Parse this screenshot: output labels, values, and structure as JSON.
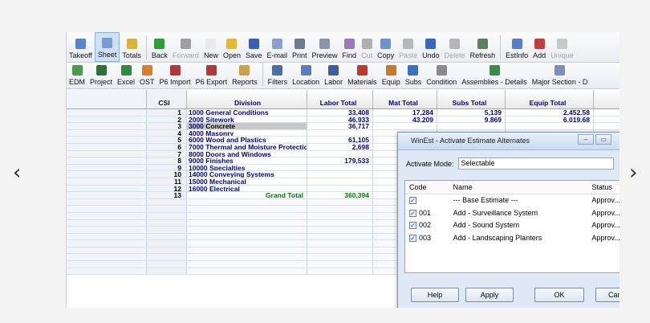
{
  "toolbar1": [
    {
      "label": "Takeoff",
      "icon": "takeoff-icon",
      "color": "#5a82c8",
      "active": false,
      "disabled": false
    },
    {
      "label": "Sheet",
      "icon": "sheet-icon",
      "color": "#7a9ad8",
      "active": true,
      "disabled": false
    },
    {
      "label": "Totals",
      "icon": "totals-icon",
      "color": "#d8b240",
      "active": false,
      "disabled": false
    },
    {
      "sep": true
    },
    {
      "label": "Back",
      "icon": "back-icon",
      "color": "#2f9c3a",
      "active": false,
      "disabled": false
    },
    {
      "label": "Forward",
      "icon": "forward-icon",
      "color": "#a0a0a0",
      "active": false,
      "disabled": true
    },
    {
      "label": "New",
      "icon": "new-icon",
      "color": "#e8e8e8",
      "active": false,
      "disabled": false
    },
    {
      "label": "Open",
      "icon": "open-icon",
      "color": "#e2b93a",
      "active": false,
      "disabled": false
    },
    {
      "label": "Save",
      "icon": "save-icon",
      "color": "#3b5fb0",
      "active": false,
      "disabled": false
    },
    {
      "label": "E-mail",
      "icon": "email-icon",
      "color": "#8aa2c8",
      "active": false,
      "disabled": false
    },
    {
      "label": "Print",
      "icon": "print-icon",
      "color": "#6d7b8c",
      "active": false,
      "disabled": false
    },
    {
      "label": "Preview",
      "icon": "preview-icon",
      "color": "#8c96a6",
      "active": false,
      "disabled": false
    },
    {
      "label": "Find",
      "icon": "find-icon",
      "color": "#9a7bb8",
      "active": false,
      "disabled": false
    },
    {
      "label": "Cut",
      "icon": "cut-icon",
      "color": "#b0b0b0",
      "active": false,
      "disabled": true
    },
    {
      "label": "Copy",
      "icon": "copy-icon",
      "color": "#6f94c8",
      "active": false,
      "disabled": false
    },
    {
      "label": "Paste",
      "icon": "paste-icon",
      "color": "#b9b9b9",
      "active": false,
      "disabled": true
    },
    {
      "label": "Undo",
      "icon": "undo-icon",
      "color": "#3c66b6",
      "active": false,
      "disabled": false
    },
    {
      "label": "Delete",
      "icon": "delete-icon",
      "color": "#b6b6b6",
      "active": false,
      "disabled": true
    },
    {
      "label": "Refresh",
      "icon": "refresh-icon",
      "color": "#5f7f5c",
      "active": false,
      "disabled": false
    },
    {
      "sep": true
    },
    {
      "label": "EstInfo",
      "icon": "estinfo-icon",
      "color": "#5a7fc0",
      "active": false,
      "disabled": false
    },
    {
      "label": "Add",
      "icon": "add-icon",
      "color": "#c04040",
      "active": false,
      "disabled": false
    },
    {
      "label": "Unique",
      "icon": "unique-icon",
      "color": "#c8c8c8",
      "active": false,
      "disabled": true
    }
  ],
  "toolbar2": [
    {
      "label": "EDM",
      "icon": "edm-icon",
      "color": "#4c9a4c"
    },
    {
      "label": "Project",
      "icon": "project-icon",
      "color": "#2f6f3a"
    },
    {
      "label": "Excel",
      "icon": "excel-icon",
      "color": "#2e8b3e"
    },
    {
      "label": "OST",
      "icon": "ost-icon",
      "color": "#e07a2a"
    },
    {
      "label": "P6 Import",
      "icon": "p6-import-icon",
      "color": "#b03838"
    },
    {
      "label": "P6 Export",
      "icon": "p6-export-icon",
      "color": "#b03838"
    },
    {
      "label": "Reports",
      "icon": "reports-icon",
      "color": "#c9a24a"
    },
    {
      "sep": true
    },
    {
      "label": "Filters",
      "icon": "filters-icon",
      "color": "#4b6ea8"
    },
    {
      "label": "Location",
      "icon": "location-icon",
      "color": "#5a7fc0"
    },
    {
      "label": "Labor",
      "icon": "labor-icon",
      "color": "#3e5f9c"
    },
    {
      "label": "Materials",
      "icon": "materials-icon",
      "color": "#c0392b"
    },
    {
      "label": "Equip",
      "icon": "equip-icon",
      "color": "#c97a2a"
    },
    {
      "label": "Subs",
      "icon": "subs-icon",
      "color": "#3b6fc0"
    },
    {
      "label": "Condition",
      "icon": "condition-icon",
      "color": "#8a8a8a"
    },
    {
      "label": "Assemblies - Details",
      "icon": "assemblies-icon",
      "color": "#3c8a4a"
    },
    {
      "label": "Major Section - D",
      "icon": "major-section-icon",
      "color": "#7c8fb8"
    }
  ],
  "grid": {
    "headers": [
      "",
      "CSI",
      "Division",
      "Labor Total",
      "Mat Total",
      "Subs Total",
      "Equip Total",
      ""
    ],
    "rows": [
      {
        "num": "1",
        "csi": "1000",
        "division": "General Conditions",
        "labor": "33,408",
        "mat": "17,284",
        "subs": "5,139",
        "equip": "2,452.58"
      },
      {
        "num": "2",
        "csi": "2000",
        "division": "Sitework",
        "labor": "46,933",
        "mat": "43,209",
        "subs": "9,869",
        "equip": "6,019.68"
      },
      {
        "num": "3",
        "csi": "3000",
        "division": "Concrete",
        "labor": "36,717",
        "mat": "",
        "subs": "",
        "equip": ""
      },
      {
        "num": "4",
        "csi": "4000",
        "division": "Masonry",
        "labor": "",
        "mat": "",
        "subs": "",
        "equip": ""
      },
      {
        "num": "5",
        "csi": "6000",
        "division": "Wood and Plastics",
        "labor": "61,105",
        "mat": "",
        "subs": "",
        "equip": ""
      },
      {
        "num": "6",
        "csi": "7000",
        "division": "Thermal and Moisture Protection",
        "labor": "2,698",
        "mat": "",
        "subs": "",
        "equip": ""
      },
      {
        "num": "7",
        "csi": "8000",
        "division": "Doors and Windows",
        "labor": "",
        "mat": "",
        "subs": "",
        "equip": ""
      },
      {
        "num": "8",
        "csi": "9000",
        "division": "Finishes",
        "labor": "179,533",
        "mat": "",
        "subs": "",
        "equip": ""
      },
      {
        "num": "9",
        "csi": "10000",
        "division": "Specialties",
        "labor": "",
        "mat": "",
        "subs": "",
        "equip": ""
      },
      {
        "num": "10",
        "csi": "14000",
        "division": "Conveying Systems",
        "labor": "",
        "mat": "",
        "subs": "",
        "equip": ""
      },
      {
        "num": "11",
        "csi": "15000",
        "division": "Mechanical",
        "labor": "",
        "mat": "",
        "subs": "",
        "equip": ""
      },
      {
        "num": "12",
        "csi": "16000",
        "division": "Electrical",
        "labor": "",
        "mat": "",
        "subs": "",
        "equip": ""
      },
      {
        "num": "13",
        "csi": "",
        "division": "Grand Total",
        "labor": "360,394",
        "mat": "",
        "subs": "",
        "equip": ""
      }
    ],
    "highlight_row": 2,
    "total_row": 12,
    "blank_rows": 11
  },
  "dialog": {
    "title": "WinEst - Activate Estimate Alternates",
    "minimize": "–",
    "maximize": "▭",
    "activate_mode_label": "Activate Mode:",
    "activate_mode_value": "Selectable",
    "columns": [
      "Code",
      "Name",
      "Status"
    ],
    "items": [
      {
        "code": "",
        "name": "--- Base Estimate ---",
        "status": "Approv..."
      },
      {
        "code": "001",
        "name": "Add - Surveillance System",
        "status": "Approv..."
      },
      {
        "code": "002",
        "name": "Add - Sound System",
        "status": "Approv..."
      },
      {
        "code": "003",
        "name": "Add - Landscaping Planters",
        "status": "Approv..."
      }
    ],
    "help_label": "Help",
    "apply_label": "Apply",
    "ok_label": "OK",
    "cancel_label": "Cancel"
  },
  "carousel": {
    "prev": "‹",
    "next": "›"
  }
}
